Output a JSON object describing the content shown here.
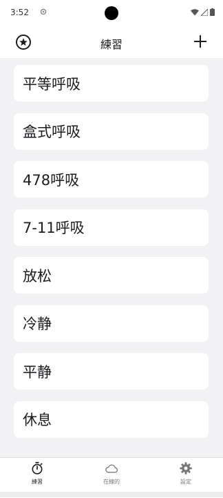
{
  "status": {
    "time": "3:52",
    "dot": "·"
  },
  "app_bar": {
    "title": "練習",
    "star_icon": "star-circle-icon",
    "add_icon": "plus-icon"
  },
  "exercises": [
    {
      "label": "平等呼吸"
    },
    {
      "label": "盒式呼吸"
    },
    {
      "label": "478呼吸"
    },
    {
      "label": "7-11呼吸"
    },
    {
      "label": "放松"
    },
    {
      "label": "冷静"
    },
    {
      "label": "平静"
    },
    {
      "label": "休息"
    }
  ],
  "bottom_nav": {
    "items": [
      {
        "label": "練習",
        "icon": "stopwatch-icon",
        "active": true
      },
      {
        "label": "在線的",
        "icon": "cloud-icon",
        "active": false
      },
      {
        "label": "設定",
        "icon": "gear-icon",
        "active": false
      }
    ]
  },
  "colors": {
    "background": "#f2f1f4",
    "card": "#ffffff",
    "text": "#1c1b1f",
    "inactive": "#777777"
  }
}
